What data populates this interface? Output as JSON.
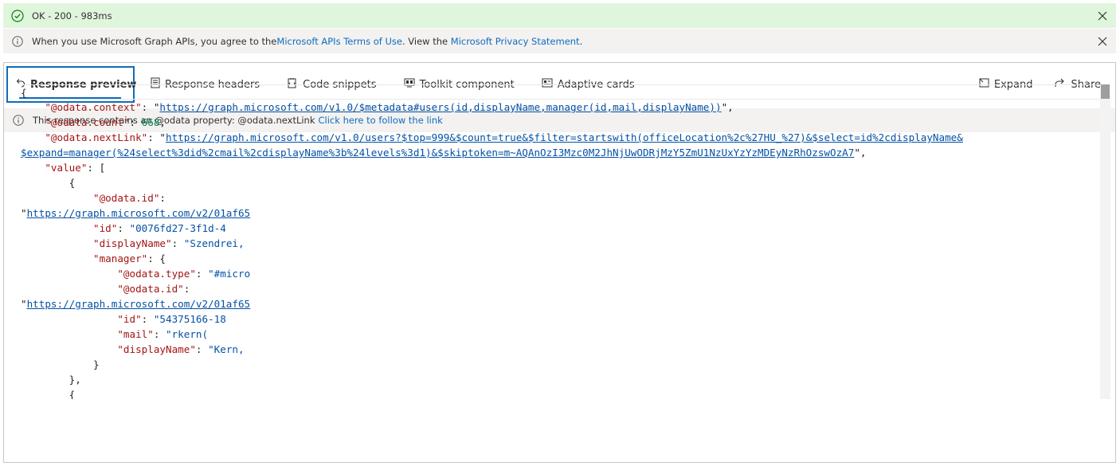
{
  "status": {
    "text": "OK - 200 - 983ms"
  },
  "terms": {
    "prefix": "When you use Microsoft Graph APIs, you agree to the ",
    "terms_link": "Microsoft APIs Terms of Use",
    "middle": ". View the ",
    "privacy_link": "Microsoft Privacy Statement",
    "suffix": "."
  },
  "tabs": {
    "response_preview": "Response preview",
    "response_headers": "Response headers",
    "code_snippets": "Code snippets",
    "toolkit_component": "Toolkit component",
    "adaptive_cards": "Adaptive cards",
    "expand": "Expand",
    "share": "Share"
  },
  "notice": {
    "text": "This response contains an @odata property: @odata.nextLink",
    "link": "Click here to follow the link"
  },
  "json": {
    "open_brace": "{",
    "ctx_key": "\"@odata.context\"",
    "ctx_val": "https://graph.microsoft.com/v1.0/$metadata#users(id,displayName,manager(id,mail,displayName))",
    "count_key": "\"@odata.count\"",
    "count_val": "668",
    "next_key": "\"@odata.nextLink\"",
    "next_val_1": "https://graph.microsoft.com/v1.0/users?$top=999&$count=true&$filter=startswith(officeLocation%2c%27HU_%27)&$select=id%2cdisplayName&",
    "next_val_2": "$expand=manager(%24select%3did%2cmail%2cdisplayName%3b%24levels%3d1)&$skiptoken=m~AQAnOzI3Mzc0M2JhNjUwODRjMzY5ZmU1NzUxYzYzMDEyNzRhOzswOzA7",
    "value_key": "\"value\"",
    "open_bracket": "[",
    "item_open": "{",
    "odata_id_key": "\"@odata.id\"",
    "odata_id_val": "https://graph.microsoft.com/v2/01af65",
    "id_key": "\"id\"",
    "id_val": "\"0076fd27-3f1d-4",
    "display_key": "\"displayName\"",
    "display_val": "\"Szendrei,",
    "manager_key": "\"manager\"",
    "mgr_type_key": "\"@odata.type\"",
    "mgr_type_val": "\"#micro",
    "mgr_odata_id_key": "\"@odata.id\"",
    "mgr_odata_id_val": "https://graph.microsoft.com/v2/01af65",
    "mgr_id_key": "\"id\"",
    "mgr_id_val": "\"54375166-18",
    "mgr_mail_key": "\"mail\"",
    "mgr_mail_val": "\"rkern(",
    "mgr_display_key": "\"displayName\"",
    "mgr_display_val": "\"Kern,",
    "mgr_close": "}",
    "item_close": "},",
    "next_item_open": "{"
  },
  "colors": {
    "success_bg": "#dff6dd",
    "success_icon": "#107c10",
    "link": "#0f6cbd",
    "json_key": "#a31515",
    "json_string": "#0451a5",
    "json_number": "#098658"
  },
  "icons": {
    "status": "check-circle-icon",
    "info": "info-icon",
    "close": "close-icon",
    "response_preview": "undo-arrow-icon",
    "response_headers": "document-icon",
    "code_snippets": "code-snippet-icon",
    "toolkit_component": "toolkit-icon",
    "adaptive_cards": "card-icon",
    "expand": "expand-icon",
    "share": "share-icon"
  }
}
